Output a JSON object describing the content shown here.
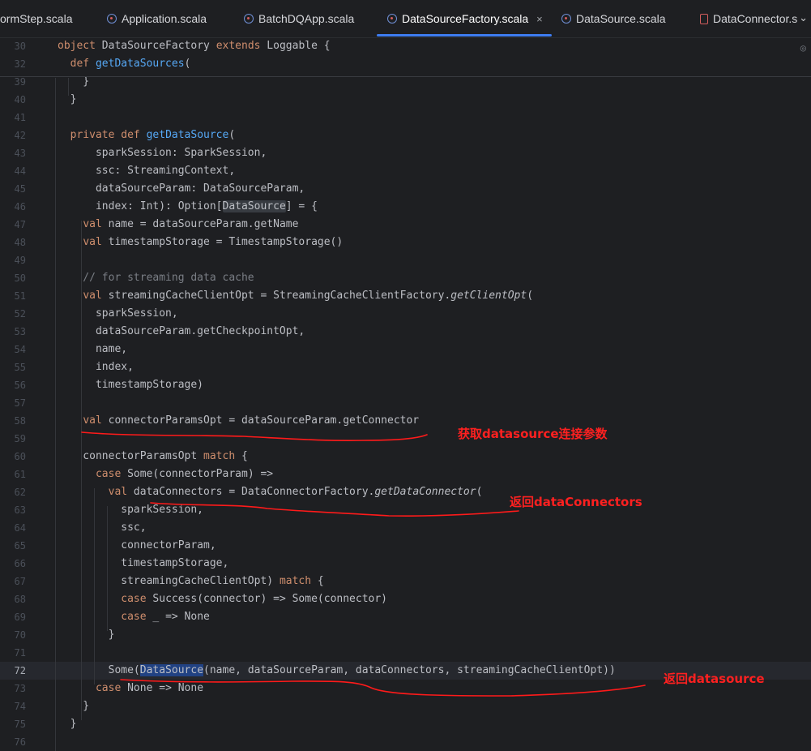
{
  "tabs": [
    {
      "label": "ormStep.scala",
      "icon": "scala-file-icon",
      "active": false
    },
    {
      "label": "Application.scala",
      "icon": "scala-file-icon",
      "active": false
    },
    {
      "label": "BatchDQApp.scala",
      "icon": "scala-file-icon",
      "active": false
    },
    {
      "label": "DataSourceFactory.scala",
      "icon": "scala-file-icon",
      "active": true,
      "close": "×"
    },
    {
      "label": "DataSource.scala",
      "icon": "scala-file-icon",
      "active": false
    },
    {
      "label": "DataConnector.s",
      "icon": "database-file-icon",
      "active": false
    }
  ],
  "tab_overflow": "⌄",
  "current_line": "72",
  "lines": [
    {
      "n": "30",
      "t": "object DataSourceFactory extends Loggable {"
    },
    {
      "n": "32",
      "t": "  def getDataSources("
    },
    {
      "n": "39",
      "t": "    }"
    },
    {
      "n": "40",
      "t": "  }"
    },
    {
      "n": "41",
      "t": ""
    },
    {
      "n": "42",
      "t": "  private def getDataSource("
    },
    {
      "n": "43",
      "t": "      sparkSession: SparkSession,"
    },
    {
      "n": "44",
      "t": "      ssc: StreamingContext,"
    },
    {
      "n": "45",
      "t": "      dataSourceParam: DataSourceParam,"
    },
    {
      "n": "46",
      "t": "      index: Int): Option[DataSource] = {"
    },
    {
      "n": "47",
      "t": "    val name = dataSourceParam.getName"
    },
    {
      "n": "48",
      "t": "    val timestampStorage = TimestampStorage()"
    },
    {
      "n": "49",
      "t": ""
    },
    {
      "n": "50",
      "t": "    // for streaming data cache"
    },
    {
      "n": "51",
      "t": "    val streamingCacheClientOpt = StreamingCacheClientFactory.getClientOpt("
    },
    {
      "n": "52",
      "t": "      sparkSession,"
    },
    {
      "n": "53",
      "t": "      dataSourceParam.getCheckpointOpt,"
    },
    {
      "n": "54",
      "t": "      name,"
    },
    {
      "n": "55",
      "t": "      index,"
    },
    {
      "n": "56",
      "t": "      timestampStorage)"
    },
    {
      "n": "57",
      "t": ""
    },
    {
      "n": "58",
      "t": "    val connectorParamsOpt = dataSourceParam.getConnector"
    },
    {
      "n": "59",
      "t": ""
    },
    {
      "n": "60",
      "t": "    connectorParamsOpt match {"
    },
    {
      "n": "61",
      "t": "      case Some(connectorParam) =>"
    },
    {
      "n": "62",
      "t": "        val dataConnectors = DataConnectorFactory.getDataConnector("
    },
    {
      "n": "63",
      "t": "          sparkSession,"
    },
    {
      "n": "64",
      "t": "          ssc,"
    },
    {
      "n": "65",
      "t": "          connectorParam,"
    },
    {
      "n": "66",
      "t": "          timestampStorage,"
    },
    {
      "n": "67",
      "t": "          streamingCacheClientOpt) match {"
    },
    {
      "n": "68",
      "t": "          case Success(connector) => Some(connector)"
    },
    {
      "n": "69",
      "t": "          case _ => None"
    },
    {
      "n": "70",
      "t": "        }"
    },
    {
      "n": "71",
      "t": ""
    },
    {
      "n": "72",
      "t": "        Some(DataSource(name, dataSourceParam, dataConnectors, streamingCacheClientOpt))"
    },
    {
      "n": "73",
      "t": "      case None => None"
    },
    {
      "n": "74",
      "t": "    }"
    },
    {
      "n": "75",
      "t": "  }"
    },
    {
      "n": "76",
      "t": ""
    }
  ],
  "annotations": {
    "connector_params": "获取datasource连接参数",
    "data_connectors": "返回dataConnectors",
    "data_source": "返回datasource"
  },
  "colors": {
    "background": "#1e1f22",
    "keyword": "#cf8e6d",
    "function": "#56a8f5",
    "comment": "#7a7e85",
    "annotation_ink": "#ff2020",
    "active_tab_underline": "#3d7cf0"
  }
}
